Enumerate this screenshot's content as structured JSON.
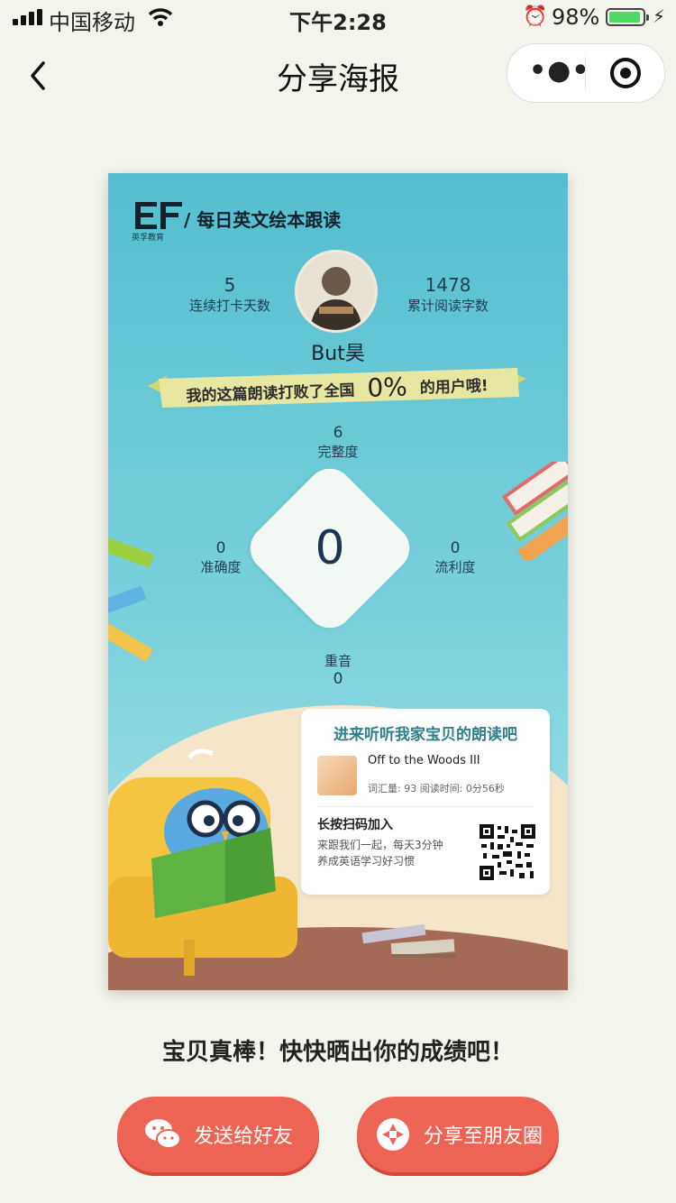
{
  "status_bar": {
    "carrier": "中国移动",
    "time": "下午2:28",
    "battery_percent": "98%",
    "battery_level": 0.98
  },
  "nav": {
    "title": "分享海报"
  },
  "poster": {
    "logo_sub": "英孚教育",
    "brand": "/ 每日英文绘本跟读",
    "streak": {
      "value": "5",
      "label": "连续打卡天数"
    },
    "words": {
      "value": "1478",
      "label": "累计阅读字数"
    },
    "username": "But昊",
    "banner": {
      "prefix": "我的这篇朗读打败了全国",
      "percent": "0%",
      "suffix": "的用户哦!"
    },
    "completeness": {
      "value": "6",
      "label": "完整度"
    },
    "accuracy": {
      "value": "0",
      "label": "准确度"
    },
    "fluency": {
      "value": "0",
      "label": "流利度"
    },
    "stress": {
      "value": "0",
      "label": "重音"
    },
    "score": "0",
    "card": {
      "heading": "进来听听我家宝贝的朗读吧",
      "book_title": "Off to the Woods III",
      "meta": "词汇量: 93  阅读时间: 0分56秒",
      "join": "长按扫码加入",
      "desc_line1": "来跟我们一起，每天3分钟",
      "desc_line2": "养成英语学习好习惯"
    }
  },
  "caption": "宝贝真棒！快快晒出你的成绩吧！",
  "buttons": {
    "send_friend": "发送给好友",
    "share_moments": "分享至朋友圈"
  },
  "colors": {
    "accent": "#ee6454",
    "poster_sky": "#54bed0",
    "battery": "#4cd964"
  },
  "icons": [
    "signal-icon",
    "wifi-icon",
    "alarm-icon",
    "battery-icon",
    "charging-icon",
    "back-icon",
    "more-icon",
    "target-icon",
    "wechat-icon",
    "moments-icon"
  ]
}
